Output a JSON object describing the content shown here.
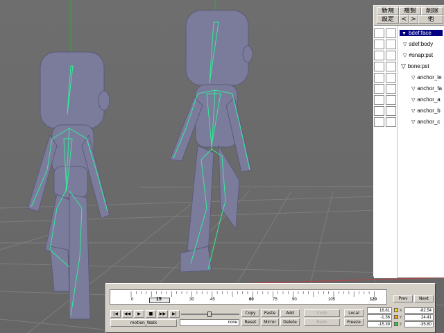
{
  "toolbar": {
    "new_label": "新規",
    "duplicate_label": "複製",
    "delete_label": "削除",
    "settings_label": "設定",
    "prev_label": "<",
    "next_label": ">",
    "other_label": "他"
  },
  "tree": {
    "items": [
      {
        "label": "bdef:face",
        "expanded": true,
        "selected": true
      },
      {
        "label": "sdef:body"
      },
      {
        "label": "#snap:pst"
      },
      {
        "label": "bone:pst",
        "expanded": true
      },
      {
        "label": "anchor_le"
      },
      {
        "label": "anchor_fa"
      },
      {
        "label": "anchor_a"
      },
      {
        "label": "anchor_b"
      },
      {
        "label": "anchor_c"
      }
    ]
  },
  "timeline": {
    "ruler_ticks": [
      "0",
      "15",
      "30",
      "45",
      "60",
      "75",
      "90",
      "105",
      "120"
    ],
    "current_frame": "15",
    "prev_label": "Prev",
    "next_label": "Next",
    "motion_name": "motion_Walk",
    "none_label": "none",
    "copy_label": "Copy",
    "paste_label": "Paste",
    "add_label": "Add",
    "undo_label": "Undo",
    "redo_label": "Redo",
    "local_label": "Local",
    "freeze_label": "Freeze",
    "reset_label": "Reset",
    "mirror_label": "Mirror",
    "delete_label": "Delete",
    "position": {
      "x": "16.81",
      "y": "-1.36",
      "z": "-15.39"
    },
    "rotation": {
      "x": "-82.54",
      "y": "24.41",
      "z": "-35.60"
    },
    "colors": {
      "x": "#ffd400",
      "y": "#ff9900",
      "z": "#33cc33"
    },
    "axis_labels": {
      "x": "X",
      "y": "Y",
      "z": "Z"
    }
  },
  "colors": {
    "skeleton": "#33ee99",
    "mesh": "#7a7a9a",
    "selection": "#000080"
  }
}
